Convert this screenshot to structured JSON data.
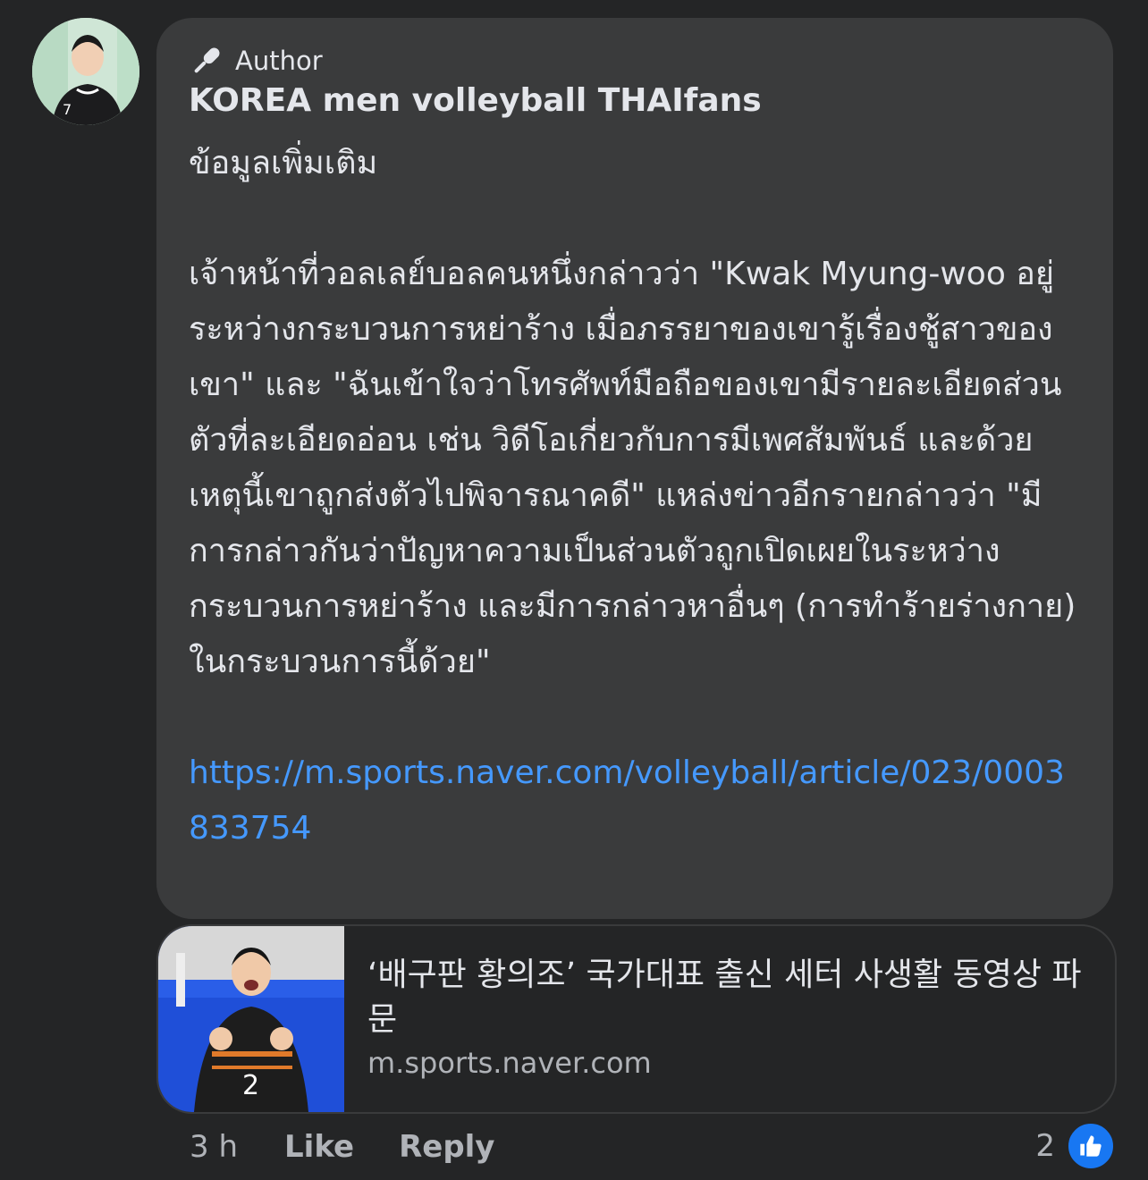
{
  "comment": {
    "badge_label": "Author",
    "author_name": "KOREA men volleyball THAIfans",
    "paragraph_1": "ข้อมูลเพิ่มเติม",
    "paragraph_2": "เจ้าหน้าที่วอลเลย์บอลคนหนึ่งกล่าวว่า \"Kwak Myung-woo อยู่ระหว่างกระบวนการหย่าร้าง เมื่อภรรยาของเขารู้เรื่องชู้สาวของเขา\" และ \"ฉันเข้าใจว่าโทรศัพท์มือถือของเขามีรายละเอียดส่วนตัวที่ละเอียดอ่อน เช่น วิดีโอเกี่ยวกับการมีเพศสัมพันธ์ และด้วยเหตุนี้เขาถูกส่งตัวไปพิจารณาคดี\" แหล่งข่าวอีกรายกล่าวว่า \"มีการกล่าวกันว่าปัญหาความเป็นส่วนตัวถูกเปิดเผยในระหว่างกระบวนการหย่าร้าง และมีการกล่าวหาอื่นๆ (การทำร้ายร่างกาย) ในกระบวนการนี้ด้วย\"",
    "link_text": "https://m.sports.naver.com/volleyball/article/023/0003833754"
  },
  "link_preview": {
    "title": "‘배구판 황의조’ 국가대표 출신 세터 사생활 동영상 파문",
    "domain": "m.sports.naver.com"
  },
  "actions": {
    "time": "3 h",
    "like_label": "Like",
    "reply_label": "Reply",
    "reaction_count": "2"
  },
  "icons": {
    "badge_icon": "microphone-icon",
    "reaction_icon": "thumbs-up-icon"
  },
  "colors": {
    "background": "#242526",
    "bubble": "#3a3b3c",
    "link": "#4599ff",
    "like_badge": "#1877f2"
  }
}
